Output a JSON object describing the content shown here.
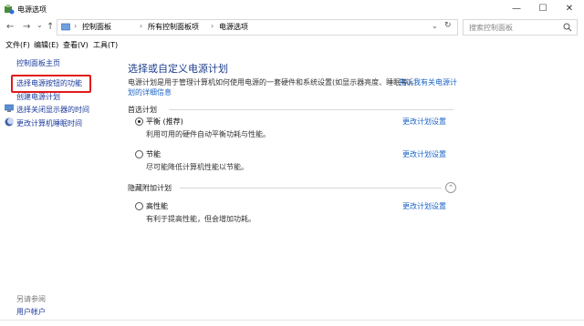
{
  "window": {
    "title": "电源选项",
    "minimize": "—",
    "maximize": "☐",
    "close": "✕"
  },
  "nav": {
    "back": "←",
    "forward": "→",
    "history": "⌄",
    "up": "↑",
    "refresh": "↻",
    "dropdown": "⌄"
  },
  "breadcrumb": [
    "控制面板",
    "所有控制面板项",
    "电源选项"
  ],
  "search": {
    "placeholder": "搜索控制面板"
  },
  "menu": [
    "文件(F)",
    "编辑(E)",
    "查看(V)",
    "工具(T)"
  ],
  "sidebar": {
    "items": [
      {
        "label": "控制面板主页"
      },
      {
        "label": "选择电源按钮的功能"
      },
      {
        "label": "创建电源计划"
      },
      {
        "label": "选择关闭显示器的时间"
      },
      {
        "label": "更改计算机睡眠时间"
      }
    ],
    "see_also": "另请参阅",
    "footer_link": "用户帐户"
  },
  "main": {
    "heading": "选择或自定义电源计划",
    "desc_line1": "电源计划是用于管理计算机如何使用电源的一套硬件和系统设置(如显示器亮度、睡眠等)。",
    "desc_link1": "告诉我有关电源计",
    "desc_link2": "划的详细信息",
    "preferred_label": "首选计划",
    "hidden_label": "隐藏附加计划",
    "change_label": "更改计划设置",
    "collapse_icon": "⌃",
    "plans": [
      {
        "name": "平衡 (推荐)",
        "desc": "利用可用的硬件自动平衡功耗与性能。",
        "selected": true
      },
      {
        "name": "节能",
        "desc": "尽可能降低计算机性能以节能。",
        "selected": false
      },
      {
        "name": "高性能",
        "desc": "有利于提高性能，但会增加功耗。",
        "selected": false
      }
    ]
  },
  "colors": {
    "accent_link": "#1a63c7",
    "heading": "#1e3f8c",
    "highlight": "#e11b1b"
  }
}
